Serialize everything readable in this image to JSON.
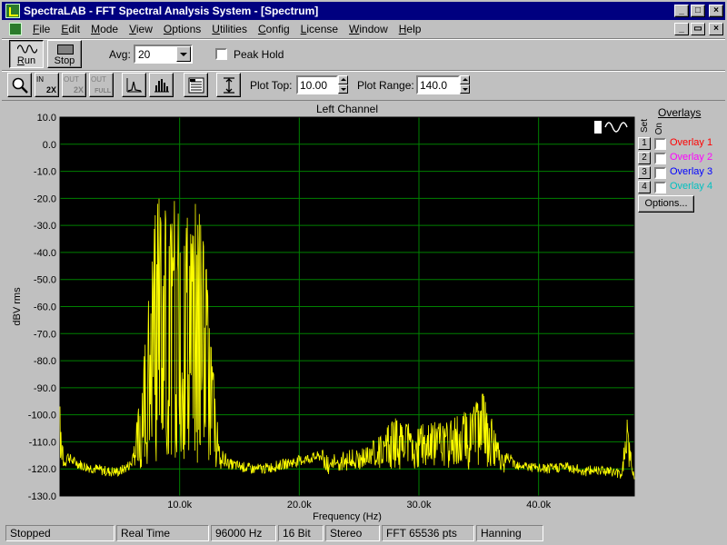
{
  "window": {
    "title": "SpectraLAB - FFT Spectral Analysis System - [Spectrum]",
    "min": "_",
    "max": "□",
    "close": "×",
    "mdi_min": "_",
    "mdi_restore": "▭",
    "mdi_close": "×"
  },
  "menu": [
    {
      "label": "File",
      "ul": "F",
      "rest": "ile"
    },
    {
      "label": "Edit",
      "ul": "E",
      "rest": "dit"
    },
    {
      "label": "Mode",
      "ul": "M",
      "rest": "ode"
    },
    {
      "label": "View",
      "ul": "V",
      "rest": "iew"
    },
    {
      "label": "Options",
      "ul": "O",
      "rest": "ptions"
    },
    {
      "label": "Utilities",
      "ul": "U",
      "rest": "tilities"
    },
    {
      "label": "Config",
      "ul": "C",
      "rest": "onfig"
    },
    {
      "label": "License",
      "ul": "L",
      "rest": "icense"
    },
    {
      "label": "Window",
      "ul": "W",
      "rest": "indow"
    },
    {
      "label": "Help",
      "ul": "H",
      "rest": "elp"
    }
  ],
  "toolbar": {
    "run_ul": "R",
    "run_rest": "un",
    "stop_label": "Stop",
    "avg_label": "Avg:",
    "avg_value": "20",
    "peak_hold_label": "Peak Hold",
    "plot_top_label": "Plot Top:",
    "plot_top_value": "10.00",
    "plot_range_label": "Plot Range:",
    "plot_range_value": "140.0",
    "zoom_in_text": "IN",
    "zoom_in_factor": "2X",
    "zoom_out_text": "OUT",
    "zoom_out_factor": "2X",
    "zoom_full_text": "OUT",
    "zoom_full_factor": "FULL"
  },
  "overlays": {
    "title": "Overlays",
    "set_label": "Set",
    "on_label": "On",
    "items": [
      {
        "set": "1",
        "name": "Overlay 1",
        "color": "#ff0000"
      },
      {
        "set": "2",
        "name": "Overlay 2",
        "color": "#ff00ff"
      },
      {
        "set": "3",
        "name": "Overlay 3",
        "color": "#0000ff"
      },
      {
        "set": "4",
        "name": "Overlay 4",
        "color": "#00c0c0"
      }
    ],
    "options_label": "Options..."
  },
  "status": {
    "state": "Stopped",
    "mode": "Real Time",
    "rate": "96000 Hz",
    "bits": "16 Bit",
    "channels": "Stereo",
    "fft": "FFT 65536 pts",
    "window": "Hanning"
  },
  "chart_data": {
    "type": "line",
    "title": "Left Channel",
    "xlabel": "Frequency (Hz)",
    "ylabel": "dBV rms",
    "xlim": [
      0,
      48000
    ],
    "ylim": [
      -130,
      10
    ],
    "x_ticks": [
      10000,
      20000,
      30000,
      40000
    ],
    "x_tick_labels": [
      "10.0k",
      "20.0k",
      "30.0k",
      "40.0k"
    ],
    "y_ticks": [
      10,
      0,
      -10,
      -20,
      -30,
      -40,
      -50,
      -60,
      -70,
      -80,
      -90,
      -100,
      -110,
      -120,
      -130
    ],
    "y_tick_labels": [
      "10.0",
      "0.0",
      "-10.0",
      "-20.0",
      "-30.0",
      "-40.0",
      "-50.0",
      "-60.0",
      "-70.0",
      "-80.0",
      "-90.0",
      "-100.0",
      "-110.0",
      "-120.0",
      "-130.0"
    ],
    "grid": true,
    "background": "#000000",
    "grid_color": "#008000",
    "trace_color": "#ffff00",
    "series": [
      {
        "x": [
          0,
          200,
          400,
          600,
          1000,
          2000,
          3000,
          4000,
          5000,
          6000,
          6500,
          7000,
          7400,
          7800,
          8200,
          8600,
          9000,
          9400,
          9800,
          10200,
          10600,
          11000,
          11400,
          11800,
          12200,
          12600,
          13000,
          13400,
          14000,
          15000,
          16000,
          17000,
          18000,
          19000,
          20000,
          21000,
          22000,
          23000,
          24000,
          25000,
          26000,
          27000,
          28000,
          29000,
          30000,
          31000,
          32000,
          33000,
          34000,
          35000,
          35400,
          36000,
          36500,
          37000,
          38000,
          39000,
          40000,
          41000,
          42000,
          43000,
          44000,
          45000,
          46000,
          47000,
          47200,
          47400,
          47800,
          48000
        ],
        "y": [
          -96,
          -110,
          -113,
          -115,
          -117,
          -119,
          -120,
          -121,
          -121,
          -118,
          -100,
          -80,
          -55,
          -30,
          -20,
          -18,
          -28,
          -22,
          -19,
          -24,
          -21,
          -18,
          -22,
          -20,
          -40,
          -70,
          -95,
          -110,
          -118,
          -119,
          -120,
          -120,
          -119,
          -118,
          -117,
          -116,
          -115,
          -114,
          -113,
          -112,
          -110,
          -106,
          -101,
          -102,
          -104,
          -102,
          -103,
          -101,
          -98,
          -94,
          -91,
          -100,
          -108,
          -114,
          -118,
          -119,
          -120,
          -120,
          -119,
          -120,
          -121,
          -120,
          -121,
          -122,
          -104,
          -96,
          -120,
          -123
        ]
      }
    ]
  }
}
